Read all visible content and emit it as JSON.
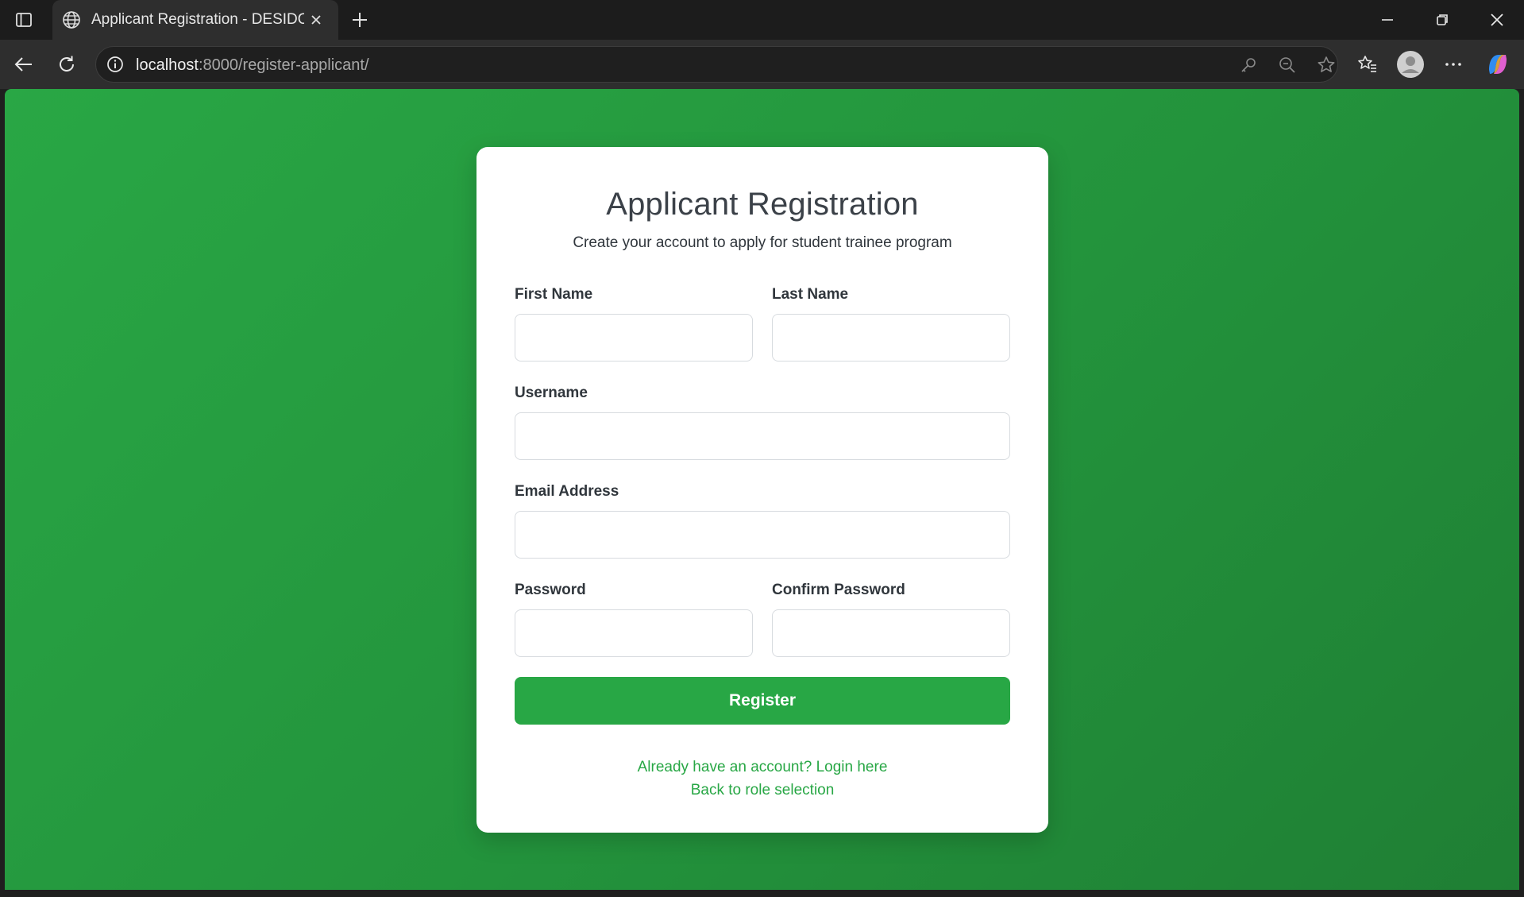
{
  "browser": {
    "tab_title": "Applicant Registration - DESIDOC",
    "url_host": "localhost",
    "url_rest": ":8000/register-applicant/"
  },
  "colors": {
    "accent": "#28a745",
    "background_gradient_start": "#29a745",
    "background_gradient_end": "#1f7f34",
    "card": "#ffffff"
  },
  "form": {
    "title": "Applicant Registration",
    "subtitle": "Create your account to apply for student trainee program",
    "fields": {
      "first_name": {
        "label": "First Name",
        "value": ""
      },
      "last_name": {
        "label": "Last Name",
        "value": ""
      },
      "username": {
        "label": "Username",
        "value": ""
      },
      "email": {
        "label": "Email Address",
        "value": ""
      },
      "password": {
        "label": "Password",
        "value": ""
      },
      "confirm_password": {
        "label": "Confirm Password",
        "value": ""
      }
    },
    "submit_label": "Register",
    "login_link": "Already have an account? Login here",
    "back_link": "Back to role selection"
  }
}
